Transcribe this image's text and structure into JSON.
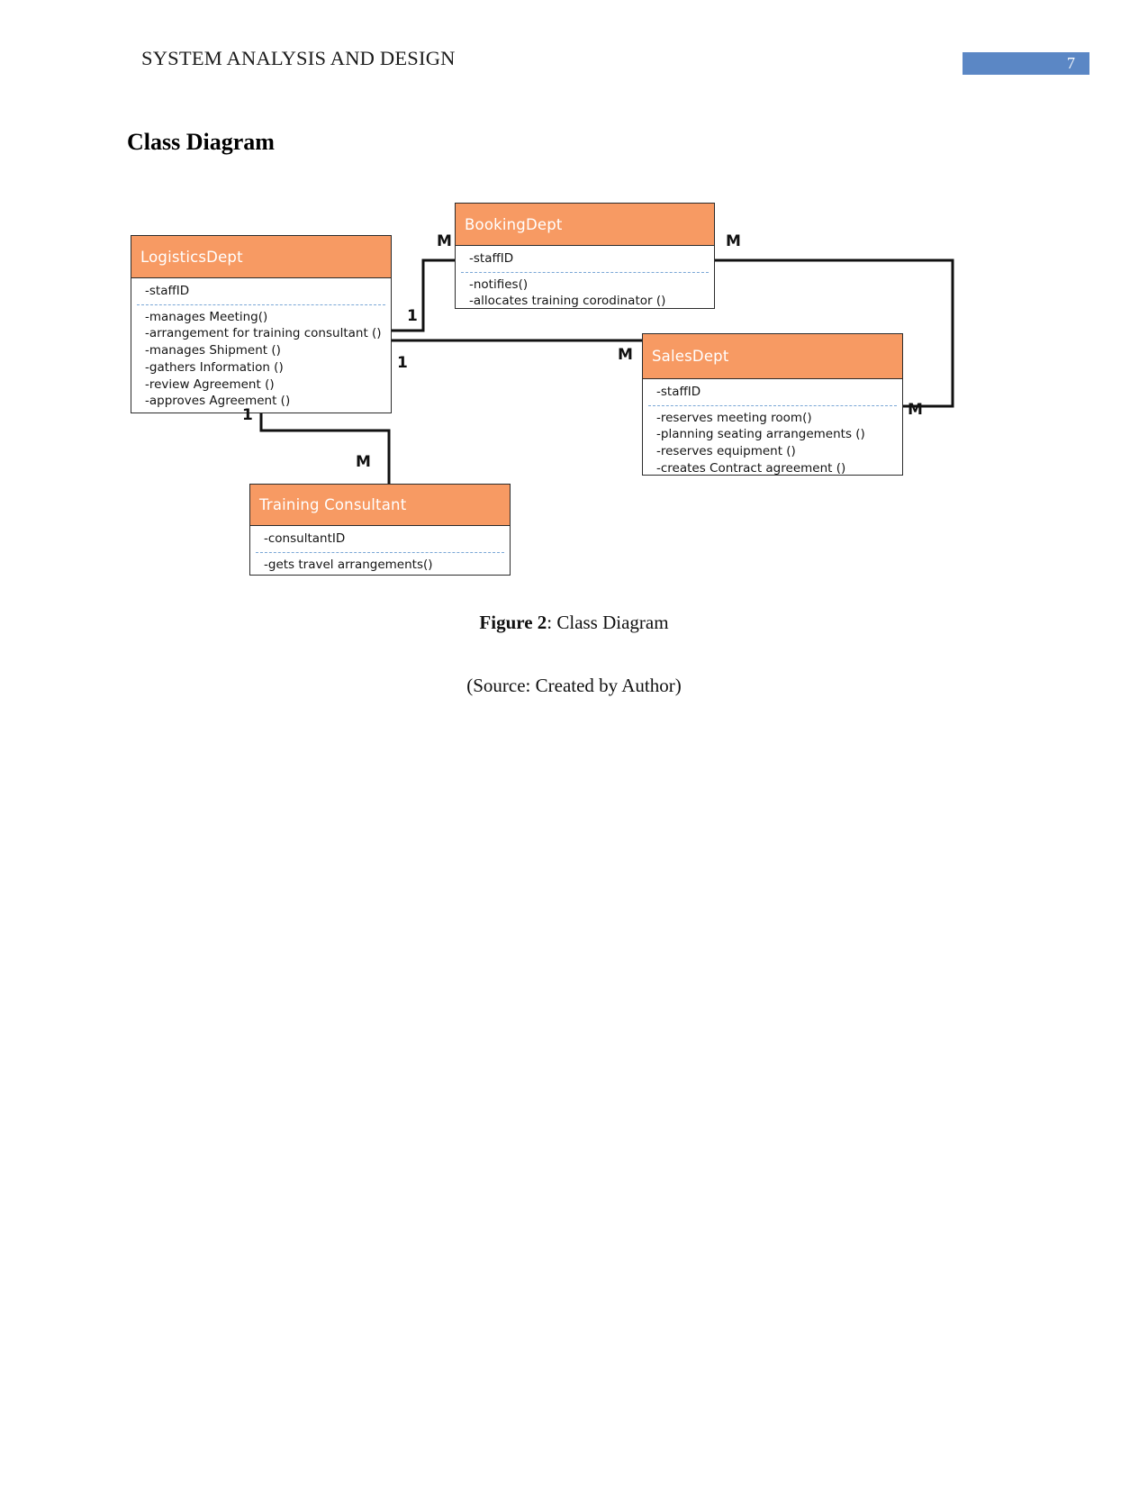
{
  "header": {
    "title": "SYSTEM ANALYSIS AND DESIGN",
    "page_number": "7",
    "badge_color": "#5b87c5"
  },
  "section": {
    "heading": "Class Diagram"
  },
  "diagram": {
    "accent_color": "#f79a63",
    "classes": [
      {
        "id": "logisticsdept",
        "name": "LogisticsDept",
        "attributes": [
          "-staffID"
        ],
        "methods": [
          "-manages Meeting()",
          "-arrangement for training consultant ()",
          "-manages Shipment ()",
          "-gathers Information ()",
          "-review Agreement ()",
          "-approves Agreement ()"
        ]
      },
      {
        "id": "bookingdept",
        "name": "BookingDept",
        "attributes": [
          "-staffID"
        ],
        "methods": [
          "-notifies()",
          "-allocates training corodinator ()"
        ]
      },
      {
        "id": "salesdept",
        "name": "SalesDept",
        "attributes": [
          "-staffID"
        ],
        "methods": [
          "-reserves meeting room()",
          "-planning seating arrangements ()",
          "-reserves equipment ()",
          "-creates Contract agreement ()"
        ]
      },
      {
        "id": "trainingconsultant",
        "name": "Training Consultant",
        "attributes": [
          "-consultantID"
        ],
        "methods": [
          "-gets travel arrangements()"
        ]
      }
    ],
    "multiplicities": {
      "booking_left": "M",
      "booking_right": "M",
      "logistics_to_booking": "1",
      "logistics_to_sales": "1",
      "sales_left": "M",
      "sales_right": "M",
      "logistics_to_training": "1",
      "training_top": "M"
    }
  },
  "caption": {
    "figure_label": "Figure 2",
    "figure_text": ": Class Diagram",
    "source": "(Source: Created by Author)"
  }
}
